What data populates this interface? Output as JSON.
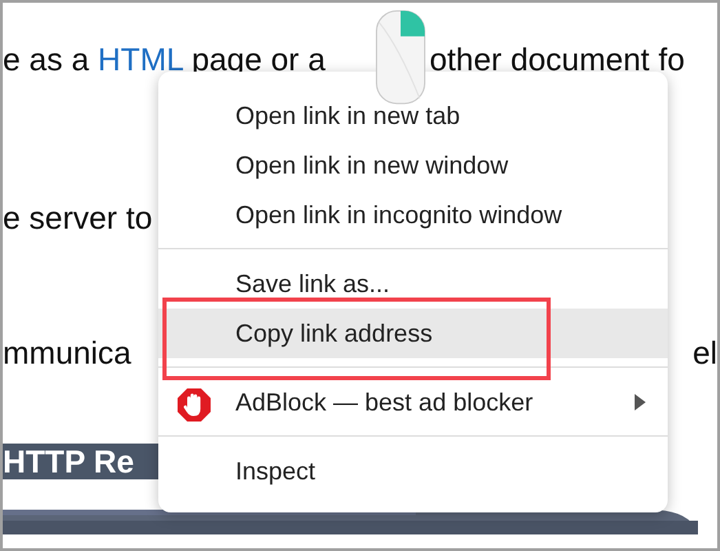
{
  "page": {
    "lines": [
      {
        "parts": [
          {
            "text": "e as a ",
            "kind": "text"
          },
          {
            "text": "HTML",
            "kind": "link"
          },
          {
            "text": " page or a",
            "kind": "text"
          },
          {
            "text": "other document fo",
            "kind": "text"
          }
        ]
      },
      {
        "parts": [
          {
            "text": "e server to",
            "kind": "text"
          }
        ]
      },
      {
        "parts": [
          {
            "text": "mmunica",
            "kind": "text"
          },
          {
            "text": "el",
            "kind": "text"
          }
        ]
      }
    ],
    "banner": {
      "text": "HTTP Re"
    }
  },
  "context_menu": {
    "groups": [
      [
        {
          "label": "Open link in new tab",
          "selected": false,
          "submenu": false,
          "kind": "item",
          "annotated": false
        },
        {
          "label": "Open link in new window",
          "selected": false,
          "submenu": false,
          "kind": "item",
          "annotated": false
        },
        {
          "label": "Open link in incognito window",
          "selected": false,
          "submenu": false,
          "kind": "item",
          "annotated": false
        }
      ],
      [
        {
          "label": "Save link as...",
          "selected": false,
          "submenu": false,
          "kind": "item",
          "annotated": false
        },
        {
          "label": "Copy link address",
          "selected": true,
          "submenu": false,
          "kind": "item",
          "annotated": true
        }
      ],
      [
        {
          "label": "AdBlock — best ad blocker",
          "selected": false,
          "submenu": true,
          "kind": "extension",
          "annotated": false
        }
      ],
      [
        {
          "label": "Inspect",
          "selected": false,
          "submenu": false,
          "kind": "item",
          "annotated": false
        }
      ]
    ]
  }
}
